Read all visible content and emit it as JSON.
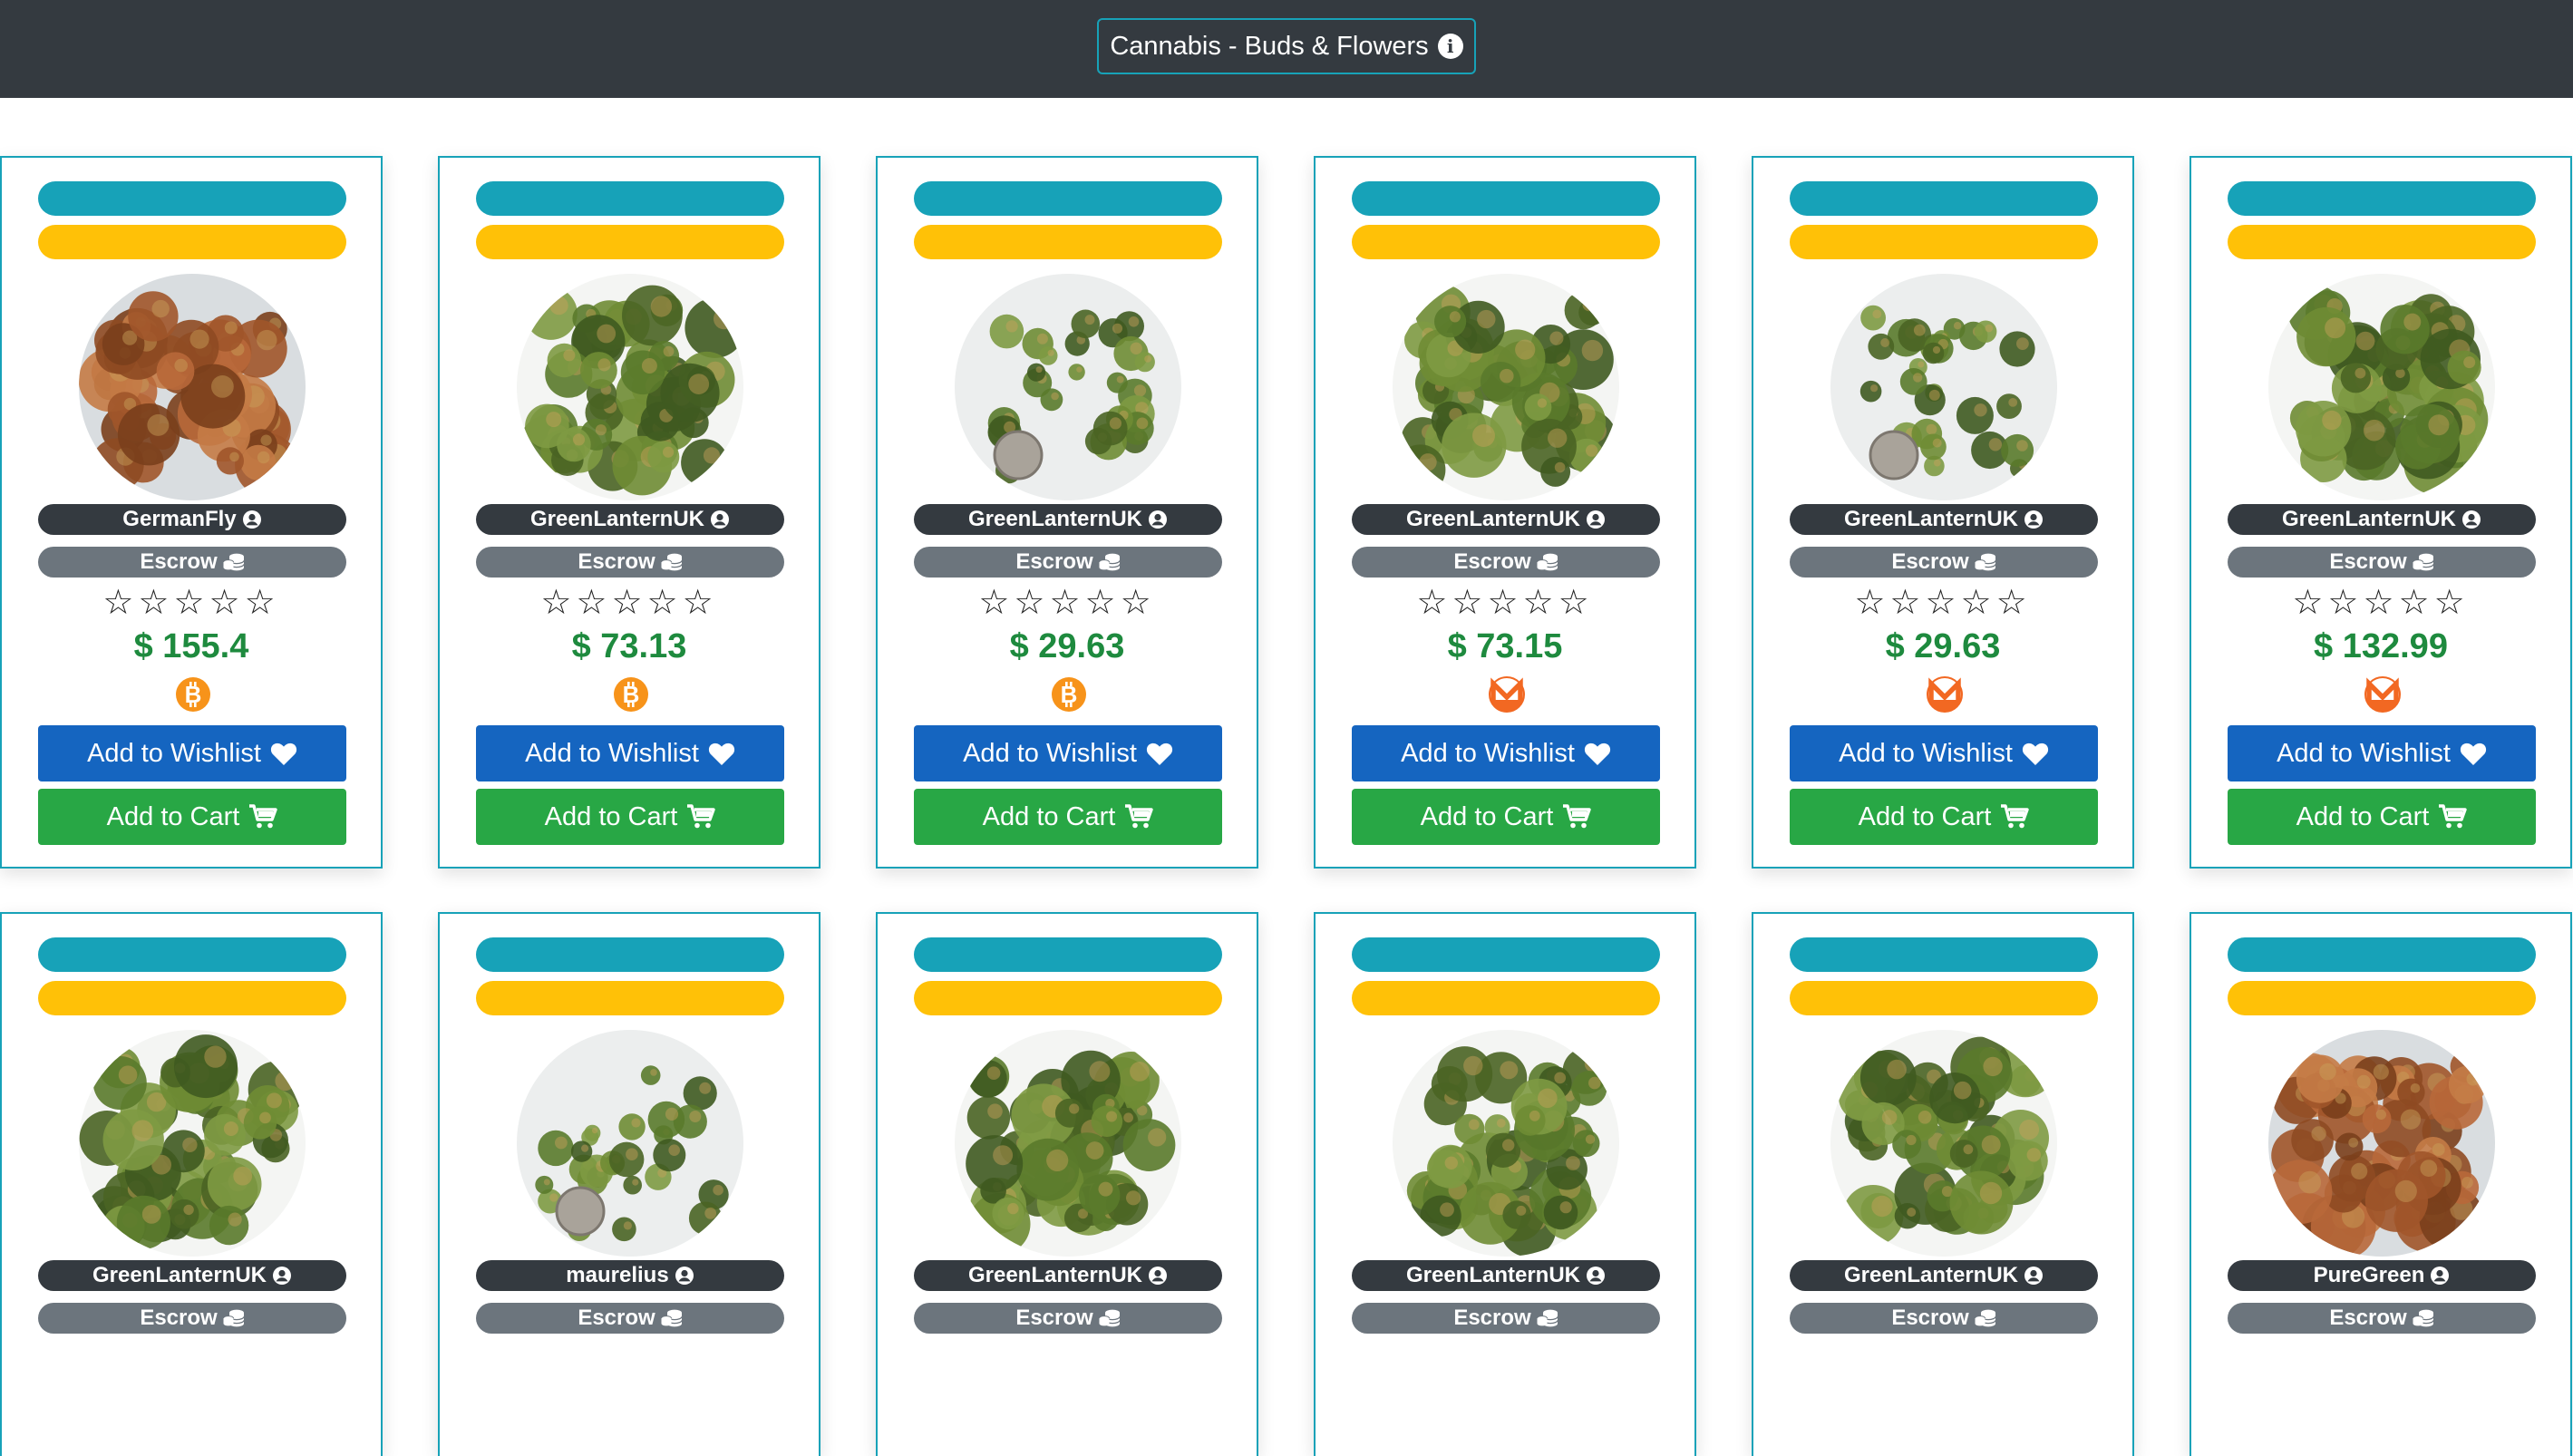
{
  "header": {
    "category_label": "Cannabis - Buds & Flowers",
    "info_icon": "info-circle-icon"
  },
  "labels": {
    "escrow": "Escrow",
    "wishlist": "Add to Wishlist",
    "cart": "Add to Cart",
    "stars": "☆☆☆☆☆"
  },
  "colors": {
    "navbar": "#343a40",
    "info": "#17a2b8",
    "warning": "#ffc107",
    "price": "#1e8a3e",
    "wishlist": "#1565c0",
    "cart": "#28a745",
    "bitcoin": "#f7931a",
    "monero": "#f26822"
  },
  "products": [
    {
      "vendor": "GermanFly",
      "price": "$ 155.4",
      "currency": "bitcoin",
      "rating": 0
    },
    {
      "vendor": "GreenLanternUK",
      "price": "$ 73.13",
      "currency": "bitcoin",
      "rating": 0
    },
    {
      "vendor": "GreenLanternUK",
      "price": "$ 29.63",
      "currency": "bitcoin",
      "rating": 0
    },
    {
      "vendor": "GreenLanternUK",
      "price": "$ 73.15",
      "currency": "monero",
      "rating": 0
    },
    {
      "vendor": "GreenLanternUK",
      "price": "$ 29.63",
      "currency": "monero",
      "rating": 0
    },
    {
      "vendor": "GreenLanternUK",
      "price": "$ 132.99",
      "currency": "monero",
      "rating": 0
    },
    {
      "vendor": "GreenLanternUK"
    },
    {
      "vendor": "maurelius"
    },
    {
      "vendor": "GreenLanternUK"
    },
    {
      "vendor": "GreenLanternUK"
    },
    {
      "vendor": "GreenLanternUK"
    },
    {
      "vendor": "PureGreen"
    }
  ]
}
